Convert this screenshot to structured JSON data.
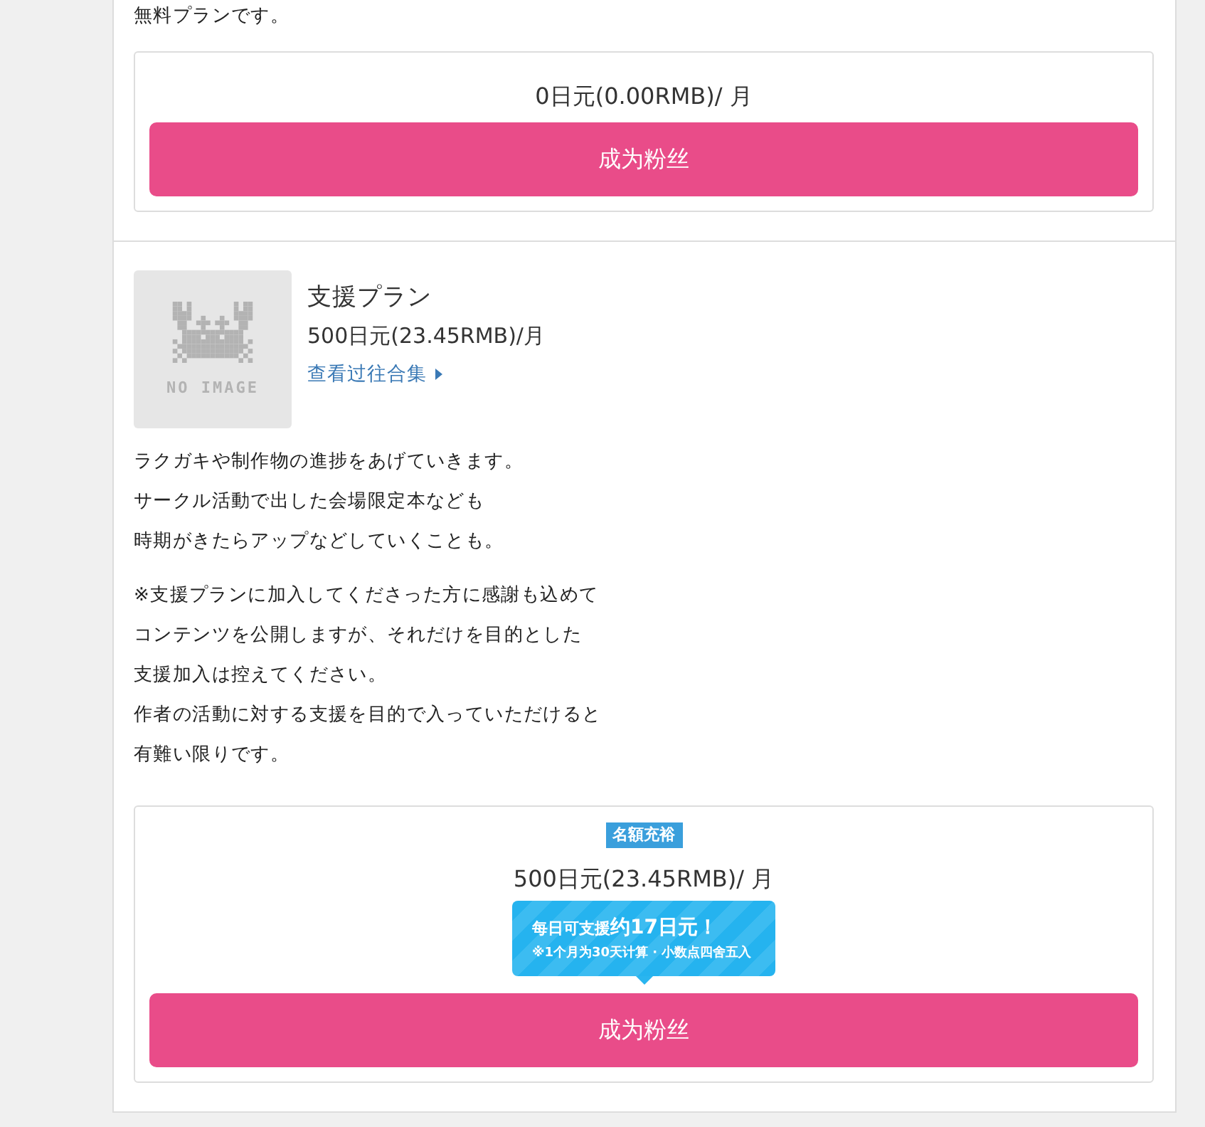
{
  "plans": [
    {
      "description": [
        [
          "無料プランです。"
        ]
      ],
      "price": "0日元(0.00RMB)/ 月",
      "button": "成为粉丝"
    },
    {
      "image_placeholder": "NO IMAGE",
      "title": "支援プラン",
      "price_line": "500日元(23.45RMB)/月",
      "link": "查看过往合集",
      "description": [
        [
          "ラクガキや制作物の進捗をあげていきます。",
          "サークル活動で出した会場限定本なども",
          "時期がきたらアップなどしていくことも。"
        ],
        [
          "※支援プランに加入してくださった方に感謝も込めて",
          "コンテンツを公開しますが、それだけを目的とした",
          "支援加入は控えてください。",
          "作者の活動に対する支援を目的で入っていただけると",
          "有難い限りです。"
        ]
      ],
      "badge": "名額充裕",
      "price": "500日元(23.45RMB)/ 月",
      "tooltip": {
        "lead": "每日可支援",
        "amount": "约17日元！",
        "note": "※1个月为30天计算 · 小数点四舍五入"
      },
      "button": "成为粉丝"
    }
  ]
}
